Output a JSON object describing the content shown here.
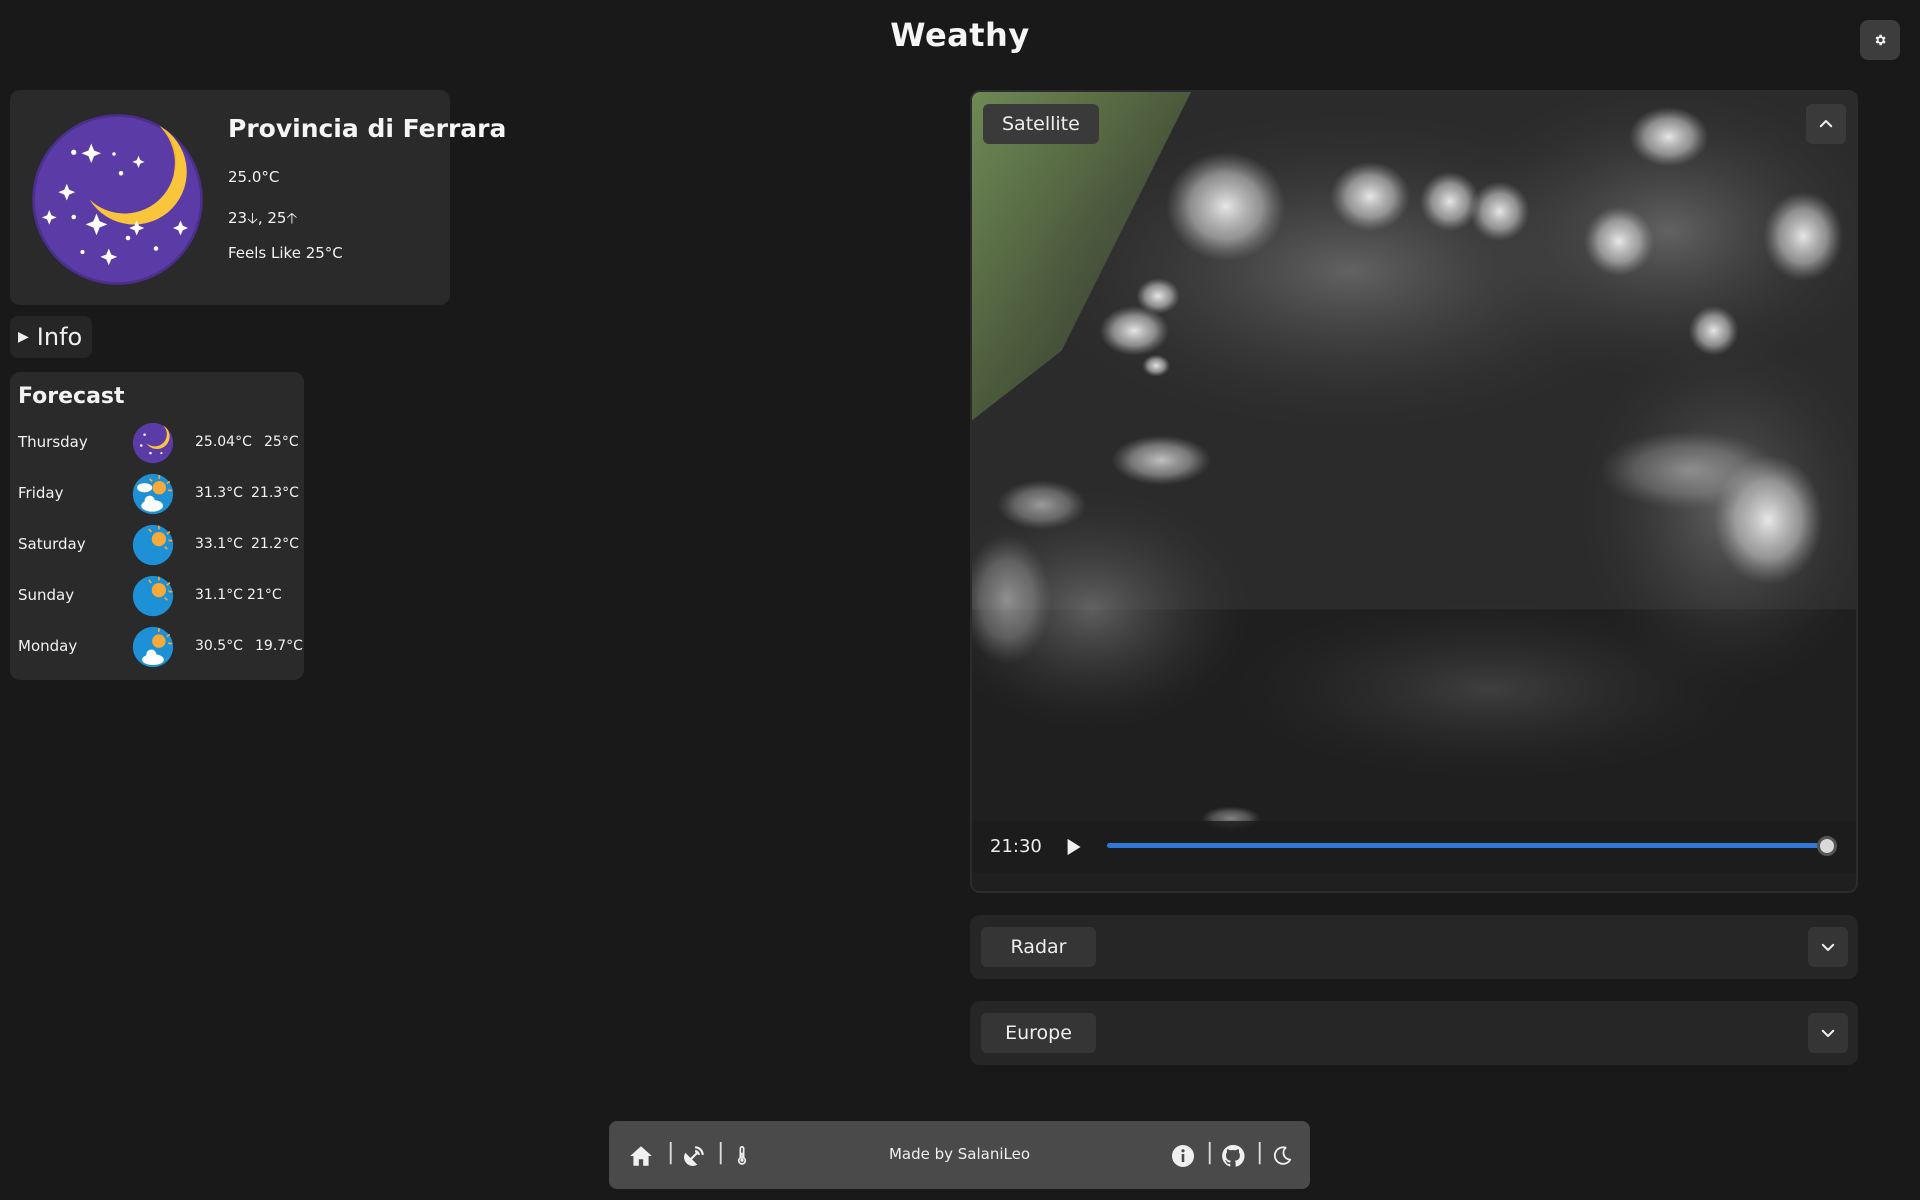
{
  "app": {
    "title": "Weathy"
  },
  "current": {
    "location": "Provincia di Ferrara",
    "temperature": "25.0°C",
    "min_max": "23🡣, 25🡡",
    "feels_like": "Feels Like 25°C",
    "icon": "clear-night-icon"
  },
  "info": {
    "label": "Info",
    "expanded": false
  },
  "forecast": {
    "title": "Forecast",
    "days": [
      {
        "day": "Thursday",
        "icon": "clear-night-icon",
        "max": "25.04°C",
        "min": "25°C"
      },
      {
        "day": "Friday",
        "icon": "partly-cloudy-day-icon",
        "max": "31.3°C",
        "min": "21.3°C"
      },
      {
        "day": "Saturday",
        "icon": "clear-day-icon",
        "max": "33.1°C",
        "min": "21.2°C"
      },
      {
        "day": "Sunday",
        "icon": "clear-day-icon",
        "max": "31.1°C",
        "min": "21°C"
      },
      {
        "day": "Monday",
        "icon": "partly-cloudy-day-icon",
        "max": "30.5°C",
        "min": "19.7°C"
      }
    ]
  },
  "satellite": {
    "label": "Satellite",
    "time": "21:30",
    "progress": 1.0,
    "accent_color": "#2f78d8"
  },
  "panels": {
    "radar": {
      "label": "Radar"
    },
    "europe": {
      "label": "Europe"
    }
  },
  "footer": {
    "credit": "Made by SalaniLeo",
    "left_icons": [
      "home-icon",
      "satellite-dish-icon",
      "thermometer-icon"
    ],
    "right_icons": [
      "info-icon",
      "github-icon",
      "moon-icon"
    ]
  }
}
